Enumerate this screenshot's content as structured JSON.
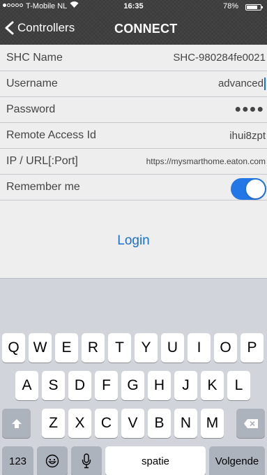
{
  "status_bar": {
    "carrier": "T-Mobile NL",
    "wifi_icon": "wifi-icon",
    "time": "16:35",
    "battery_percent": "78%",
    "battery_level": 0.78,
    "signal_bars_filled": 1,
    "signal_bars_total": 5
  },
  "nav": {
    "back_label": "Controllers",
    "title": "CONNECT"
  },
  "form": {
    "shc_name": {
      "label": "SHC Name",
      "value": "SHC-980284fe0021"
    },
    "username": {
      "label": "Username",
      "value": "advanced"
    },
    "password": {
      "label": "Password",
      "value": "●●●●"
    },
    "remote_access": {
      "label": "Remote Access Id",
      "value": "ihui8zpt"
    },
    "ip_url": {
      "label": "IP / URL[:Port]",
      "value": "https://mysmarthome.eaton.com"
    },
    "remember_me": {
      "label": "Remember me",
      "on": true
    },
    "login_label": "Login"
  },
  "keyboard": {
    "row1": [
      "Q",
      "W",
      "E",
      "R",
      "T",
      "Y",
      "U",
      "I",
      "O",
      "P"
    ],
    "row2": [
      "A",
      "S",
      "D",
      "F",
      "G",
      "H",
      "J",
      "K",
      "L"
    ],
    "row3": [
      "Z",
      "X",
      "C",
      "V",
      "B",
      "N",
      "M"
    ],
    "numbers_label": "123",
    "space_label": "spatie",
    "return_label": "Volgende",
    "icons": [
      "shift-icon",
      "delete-icon",
      "emoji-icon",
      "microphone-icon"
    ]
  },
  "colors": {
    "accent": "#2477e6",
    "link": "#1a6fd0",
    "header": "#3c3c3c",
    "form_bg": "#eeeeee",
    "keyboard_bg": "#d1d5db"
  }
}
